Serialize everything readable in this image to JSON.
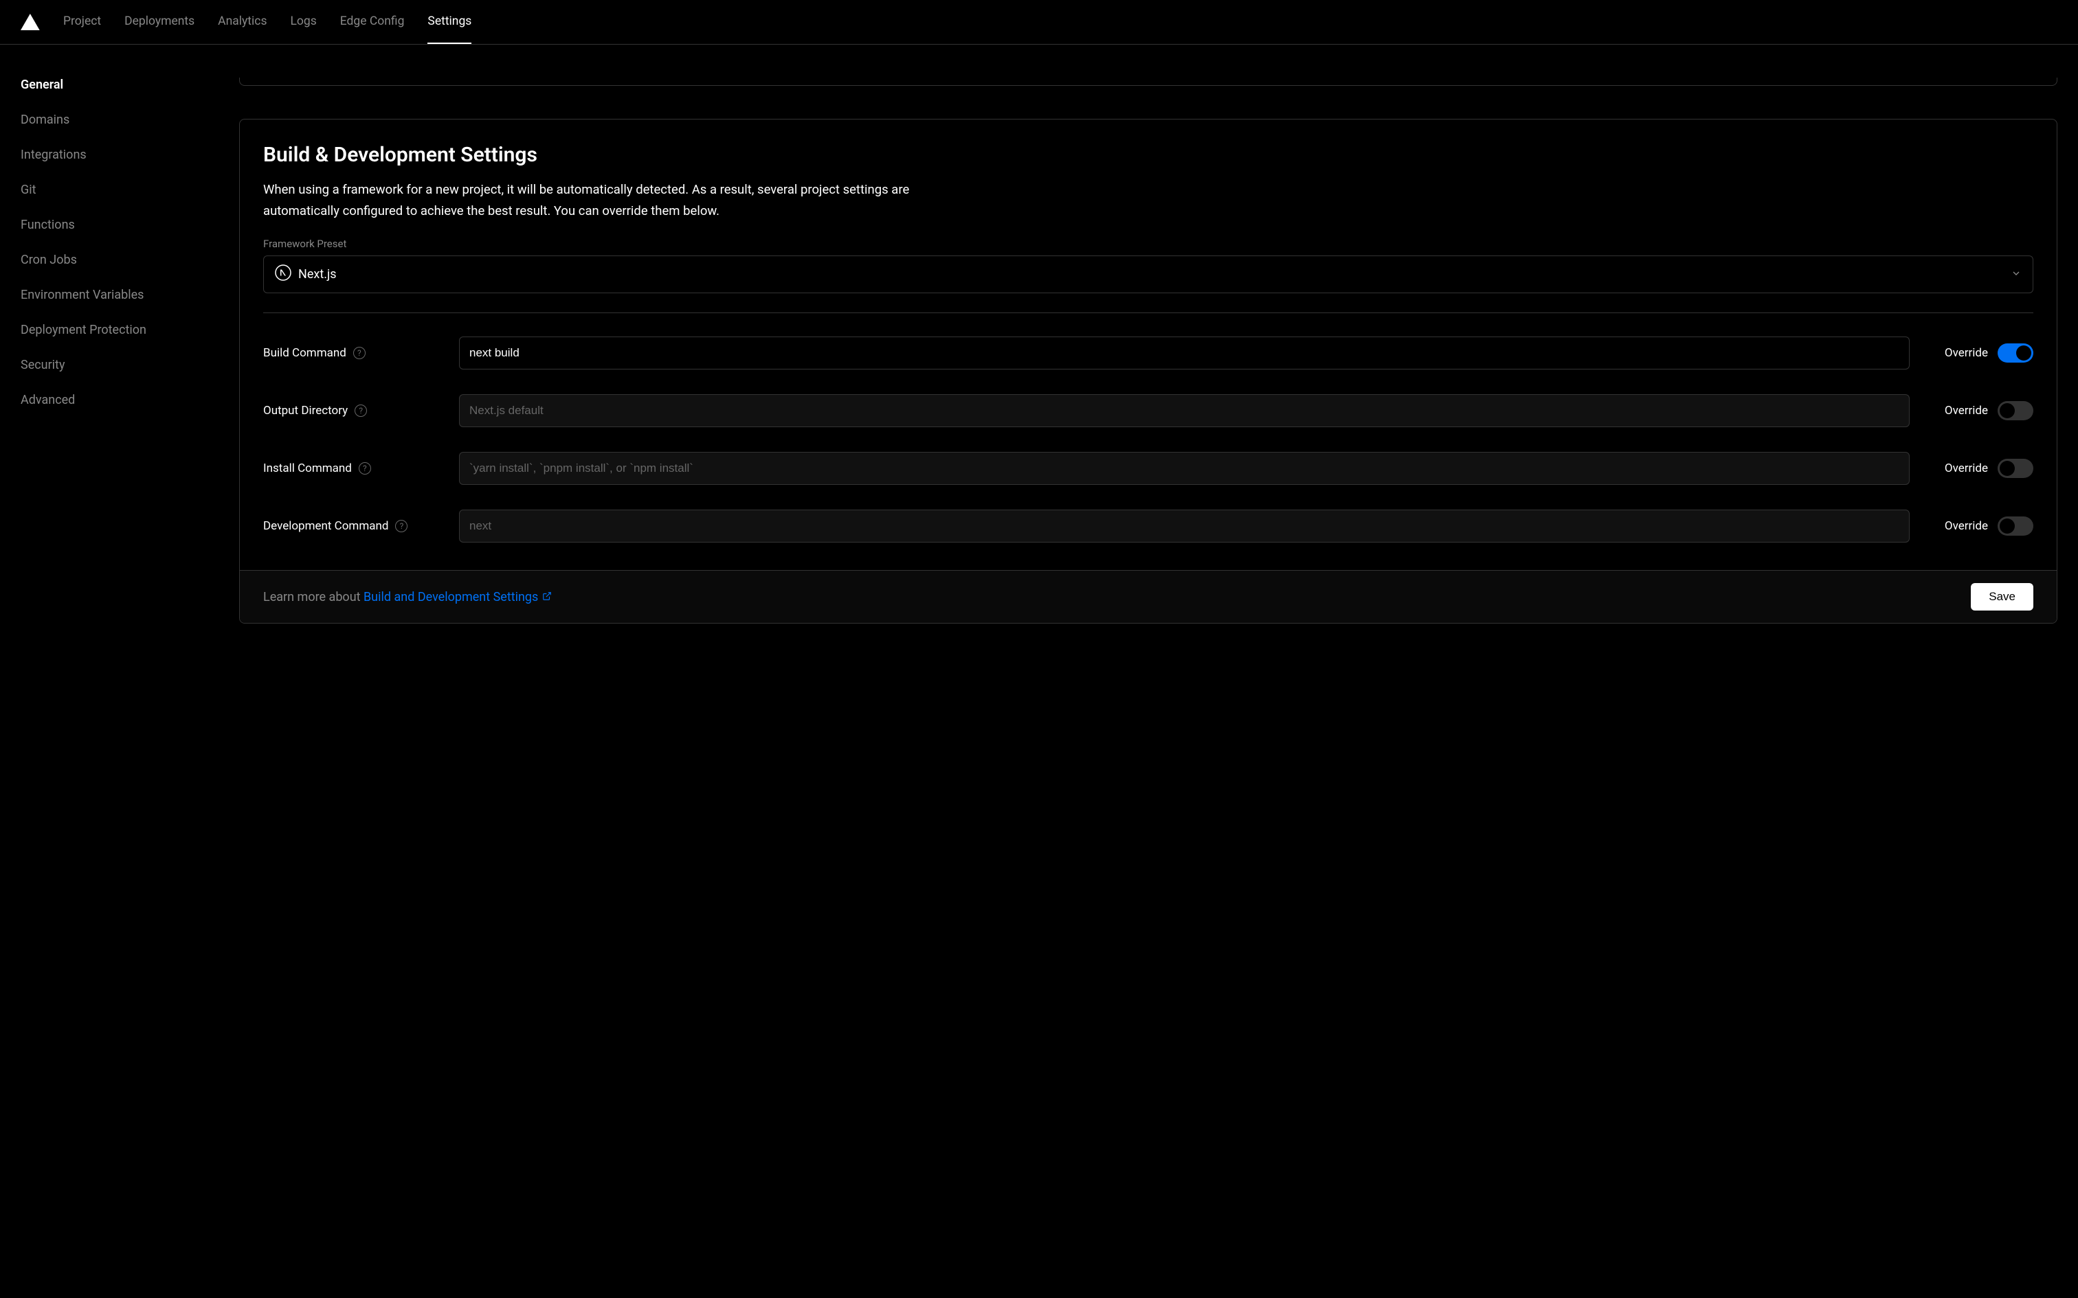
{
  "nav": {
    "tabs": [
      {
        "label": "Project"
      },
      {
        "label": "Deployments"
      },
      {
        "label": "Analytics"
      },
      {
        "label": "Logs"
      },
      {
        "label": "Edge Config"
      },
      {
        "label": "Settings",
        "active": true
      }
    ]
  },
  "sidebar": {
    "items": [
      {
        "label": "General",
        "active": true
      },
      {
        "label": "Domains"
      },
      {
        "label": "Integrations"
      },
      {
        "label": "Git"
      },
      {
        "label": "Functions"
      },
      {
        "label": "Cron Jobs"
      },
      {
        "label": "Environment Variables"
      },
      {
        "label": "Deployment Protection"
      },
      {
        "label": "Security"
      },
      {
        "label": "Advanced"
      }
    ]
  },
  "card": {
    "title": "Build & Development Settings",
    "description": "When using a framework for a new project, it will be automatically detected. As a result, several project settings are automatically configured to achieve the best result. You can override them below.",
    "framework_label": "Framework Preset",
    "framework_value": "Next.js",
    "override_label": "Override",
    "rows": {
      "build": {
        "label": "Build Command",
        "value": "next build",
        "placeholder": "",
        "override": true
      },
      "output": {
        "label": "Output Directory",
        "value": "",
        "placeholder": "Next.js default",
        "override": false
      },
      "install": {
        "label": "Install Command",
        "value": "",
        "placeholder": "`yarn install`, `pnpm install`, or `npm install`",
        "override": false
      },
      "dev": {
        "label": "Development Command",
        "value": "",
        "placeholder": "next",
        "override": false
      }
    },
    "footer": {
      "prefix": "Learn more about ",
      "link_text": "Build and Development Settings",
      "save_label": "Save"
    }
  }
}
